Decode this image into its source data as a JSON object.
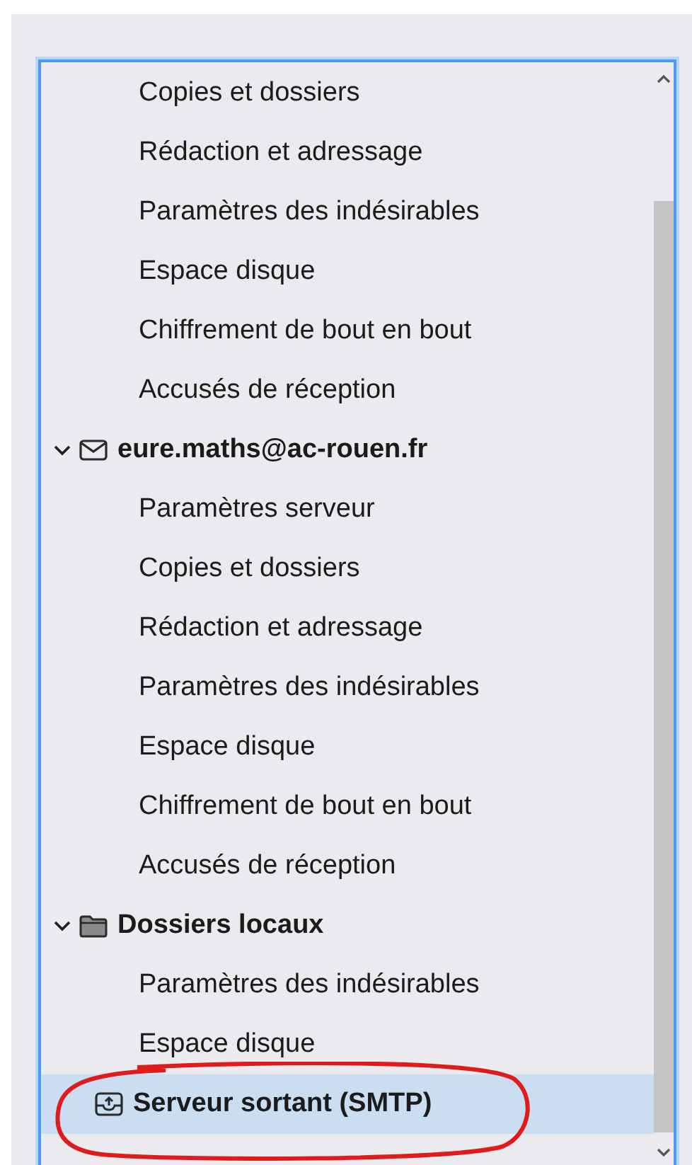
{
  "tree": [
    {
      "kind": "setting",
      "label": "Copies et dossiers",
      "selected": false
    },
    {
      "kind": "setting",
      "label": "Rédaction et adressage",
      "selected": false
    },
    {
      "kind": "setting",
      "label": "Paramètres des indésirables",
      "selected": false
    },
    {
      "kind": "setting",
      "label": "Espace disque",
      "selected": false
    },
    {
      "kind": "setting",
      "label": "Chiffrement de bout en bout",
      "selected": false
    },
    {
      "kind": "setting",
      "label": "Accusés de réception",
      "selected": false
    },
    {
      "kind": "account",
      "label": "eure.maths@ac-rouen.fr",
      "expanded": true,
      "selected": false,
      "children": [
        {
          "kind": "setting",
          "label": "Paramètres serveur",
          "selected": false
        },
        {
          "kind": "setting",
          "label": "Copies et dossiers",
          "selected": false
        },
        {
          "kind": "setting",
          "label": "Rédaction et adressage",
          "selected": false
        },
        {
          "kind": "setting",
          "label": "Paramètres des indésirables",
          "selected": false
        },
        {
          "kind": "setting",
          "label": "Espace disque",
          "selected": false
        },
        {
          "kind": "setting",
          "label": "Chiffrement de bout en bout",
          "selected": false
        },
        {
          "kind": "setting",
          "label": "Accusés de réception",
          "selected": false
        }
      ]
    },
    {
      "kind": "local",
      "label": "Dossiers locaux",
      "expanded": true,
      "selected": false,
      "children": [
        {
          "kind": "setting",
          "label": "Paramètres des indésirables",
          "selected": false
        },
        {
          "kind": "setting",
          "label": "Espace disque",
          "selected": false
        }
      ]
    },
    {
      "kind": "smtp",
      "label": "Serveur sortant (SMTP)",
      "selected": true
    }
  ]
}
